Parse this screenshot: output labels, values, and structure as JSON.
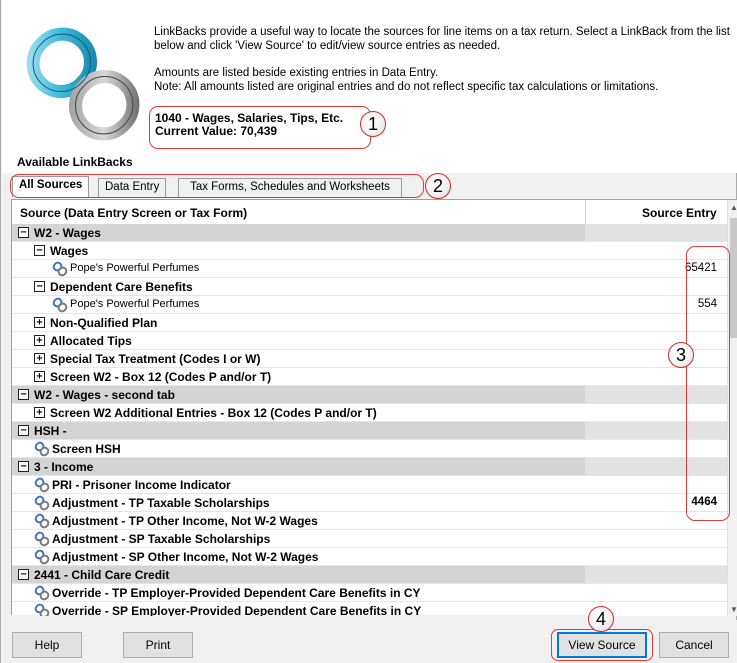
{
  "description": {
    "line1": "LinkBacks provide a useful way to locate the sources for line items on a tax return. Select a LinkBack from the list",
    "line2": "below and click 'View Source' to edit/view source entries as needed.",
    "line3": "Amounts are listed beside existing entries in Data Entry.",
    "line4": "Note: All amounts listed are original entries and do not reflect specific tax calculations or limitations."
  },
  "current": {
    "line_title": "1040 - Wages, Salaries, Tips, Etc.",
    "current_value": "Current Value: 70,439"
  },
  "available_label": "Available LinkBacks",
  "tabs": [
    {
      "label": "All Sources",
      "active": true
    },
    {
      "label": "Data Entry",
      "active": false
    },
    {
      "label": "Tax Forms, Schedules and Worksheets",
      "active": false
    }
  ],
  "columns": {
    "source": "Source (Data Entry Screen or Tax Form)",
    "entry": "Source Entry"
  },
  "rows": [
    {
      "type": "group",
      "control": "minus",
      "label": "W2 - Wages",
      "value": ""
    },
    {
      "type": "sub",
      "control": "minus",
      "label": "Wages",
      "value": ""
    },
    {
      "type": "item",
      "control": "link",
      "label": "Pope's Powerful Perfumes",
      "value": "65421"
    },
    {
      "type": "sub",
      "control": "minus",
      "label": "Dependent Care Benefits",
      "value": ""
    },
    {
      "type": "item",
      "control": "link",
      "label": "Pope's Powerful Perfumes",
      "value": "554"
    },
    {
      "type": "sub",
      "control": "plus",
      "label": "Non-Qualified Plan",
      "value": ""
    },
    {
      "type": "sub",
      "control": "plus",
      "label": "Allocated Tips",
      "value": ""
    },
    {
      "type": "sub",
      "control": "plus",
      "label": "Special Tax Treatment (Codes I or W)",
      "value": ""
    },
    {
      "type": "sub",
      "control": "plus",
      "label": "Screen W2 - Box 12 (Codes P and/or T)",
      "value": ""
    },
    {
      "type": "group",
      "control": "minus",
      "label": "W2 - Wages - second tab",
      "value": ""
    },
    {
      "type": "sub",
      "control": "plus",
      "label": "Screen W2 Additional Entries - Box 12 (Codes P and/or T)",
      "value": ""
    },
    {
      "type": "group",
      "control": "minus",
      "label": "HSH -",
      "value": ""
    },
    {
      "type": "sub",
      "control": "link",
      "label": "Screen HSH",
      "value": ""
    },
    {
      "type": "group",
      "control": "minus",
      "label": "3 - Income",
      "value": ""
    },
    {
      "type": "sub",
      "control": "link",
      "label": "PRI - Prisoner Income Indicator",
      "value": ""
    },
    {
      "type": "sub",
      "control": "link",
      "label": "Adjustment - TP Taxable Scholarships",
      "value": "4464"
    },
    {
      "type": "sub",
      "control": "link",
      "label": "Adjustment - TP Other Income, Not W-2 Wages",
      "value": ""
    },
    {
      "type": "sub",
      "control": "link",
      "label": "Adjustment - SP Taxable Scholarships",
      "value": ""
    },
    {
      "type": "sub",
      "control": "link",
      "label": "Adjustment - SP Other Income, Not W-2 Wages",
      "value": ""
    },
    {
      "type": "group",
      "control": "minus",
      "label": "2441 - Child Care Credit",
      "value": ""
    },
    {
      "type": "sub",
      "control": "link",
      "label": "Override - TP Employer-Provided Dependent Care Benefits in CY",
      "value": ""
    },
    {
      "type": "sub",
      "control": "link",
      "label": "Override - SP Employer-Provided Dependent Care Benefits in CY",
      "value": ""
    }
  ],
  "buttons": {
    "help": "Help",
    "print": "Print",
    "view_source": "View Source",
    "cancel": "Cancel"
  },
  "callouts": [
    "1",
    "2",
    "3",
    "4"
  ],
  "colors": {
    "callout_outline": "#e23a3a",
    "group_row_bg": "#d4d4d4",
    "link_icon": "#3a76c4"
  }
}
